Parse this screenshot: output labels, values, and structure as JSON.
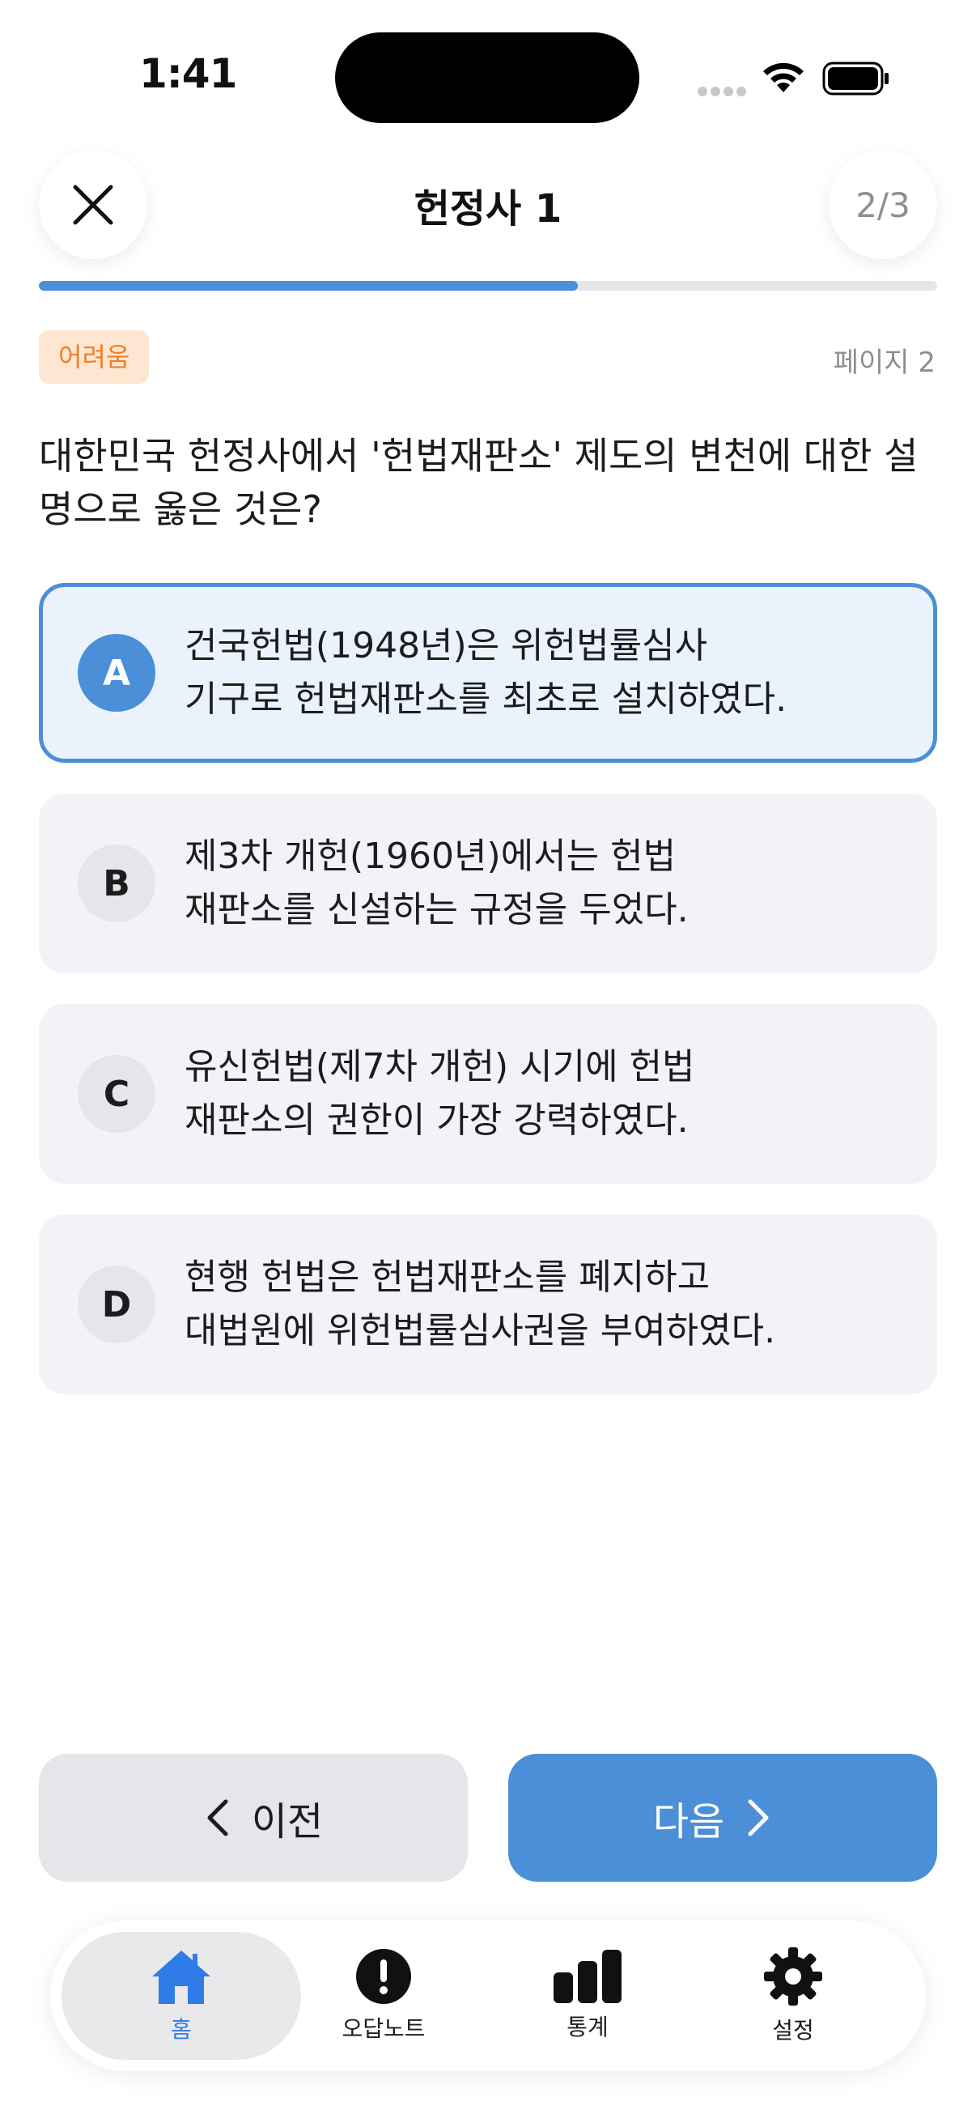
{
  "status_bar": {
    "time": "1:41"
  },
  "header": {
    "title": "헌정사 1",
    "count": "2/3",
    "progress": 0.6
  },
  "question": {
    "difficulty": "어려움",
    "page": "페이지 2",
    "text": "대한민국 헌정사에서 '헌법재판소' 제도의 변천에 대한 설명으로 옳은 것은?"
  },
  "options": [
    {
      "letter": "A",
      "line1": "건국헌법(1948년)은 위헌법률심사",
      "line2": "기구로 헌법재판소를 최초로 설치하였다.",
      "selected": true
    },
    {
      "letter": "B",
      "line1": "제3차 개헌(1960년)에서는 헌법",
      "line2": "재판소를 신설하는 규정을 두었다.",
      "selected": false
    },
    {
      "letter": "C",
      "line1": "유신헌법(제7차 개헌) 시기에 헌법",
      "line2": "재판소의 권한이 가장 강력하였다.",
      "selected": false
    },
    {
      "letter": "D",
      "line1": "현행 헌법은 헌법재판소를 폐지하고",
      "line2": "대법원에 위헌법률심사권을 부여하였다.",
      "selected": false
    }
  ],
  "navigation": {
    "prev_label": "이전",
    "next_label": "다음"
  },
  "tabs": [
    {
      "label": "홈",
      "icon": "house-icon",
      "active": true
    },
    {
      "label": "오답노트",
      "icon": "exclamation-circle-icon",
      "active": false
    },
    {
      "label": "통계",
      "icon": "bar-chart-icon",
      "active": false
    },
    {
      "label": "설정",
      "icon": "gear-icon",
      "active": false
    }
  ],
  "colors": {
    "accent": "#4a8fd8",
    "badge_bg": "#fde6d2",
    "badge_text": "#f07f2a",
    "tab_active": "#2f7be8"
  }
}
